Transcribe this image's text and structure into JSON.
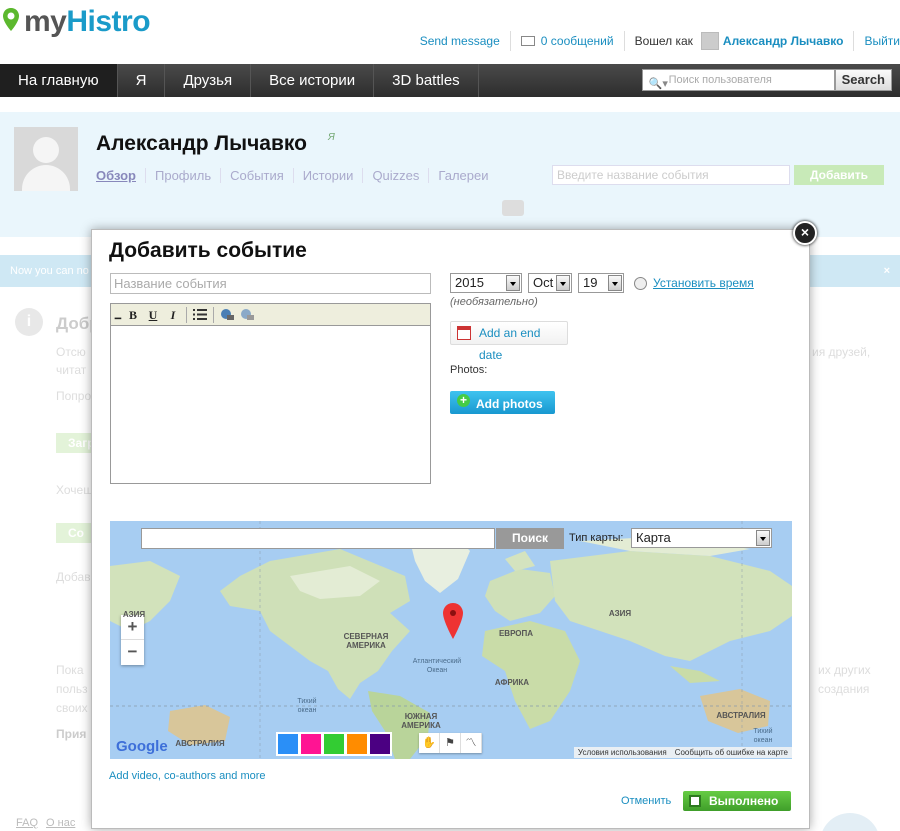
{
  "header": {
    "logo_my": "my",
    "logo_histro": "Histro",
    "send_message": "Send message",
    "messages": "0 сообщений",
    "logged_in_as": "Вошел как",
    "user_name": "Александр Лычавко",
    "logout": "Выйти"
  },
  "nav": {
    "items": [
      "На главную",
      "Я",
      "Друзья",
      "Все истории",
      "3D battles"
    ],
    "search_placeholder": "Поиск пользователя",
    "search_button": "Search"
  },
  "profile": {
    "name": "Александр Лычавко",
    "badge": "Я",
    "tabs": [
      "Обзор",
      "Профиль",
      "События",
      "Истории",
      "Quizzes",
      "Галереи"
    ],
    "event_search_placeholder": "Введите название события",
    "add_button": "Добавить"
  },
  "background": {
    "notice": "Now you can no",
    "notice_close": "×",
    "heading": "Добр",
    "p1": "Отсю",
    "p1_right": "ия друзей,",
    "p2": "читат",
    "p3": "Попро",
    "btn1": "Загр",
    "p4": "Хочеш",
    "btn2": "Со",
    "p5": "Добав",
    "p6": "Пока",
    "p6_right": "их других",
    "p7": "польз",
    "p7_right": "создания",
    "p8": "своих",
    "p9": "Прия",
    "footer_faq": "FAQ",
    "footer_about": "О нас"
  },
  "modal": {
    "title": "Добавить событие",
    "name_placeholder": "Название события",
    "close": "×",
    "toolbar": [
      "B",
      "U",
      "I"
    ],
    "year": "2015",
    "month": "Oct",
    "day": "19",
    "set_time": "Установить время",
    "optional": "(необязательно)",
    "add_end_date": "Add an end date",
    "photos_label": "Photos:",
    "add_photos": "Add photos",
    "add_video": "Add video, co-authors and more",
    "cancel": "Отменить",
    "done": "Выполнено"
  },
  "map": {
    "search_button": "Поиск",
    "type_label": "Тип карты:",
    "type_value": "Карта",
    "zoom_in": "+",
    "zoom_out": "−",
    "labels": {
      "asia_left": "АЗИЯ",
      "north_america": "СЕВЕРНАЯ АМЕРИКА",
      "europe": "ЕВРОПА",
      "asia_right": "АЗИЯ",
      "atlantic": "Атлантический Океан",
      "africa": "АФРИКА",
      "south_america": "ЮЖНАЯ АМЕРИКА",
      "australia_left": "АВСТРАЛИЯ",
      "australia_right": "АВСТРАЛИЯ",
      "pacific_left": "Тихий океан",
      "pacific_right": "Тихий океан"
    },
    "google": "Google",
    "terms": "Условия использования",
    "report": "Сообщить об ошибке на карте",
    "palette_colors": [
      "#2a8ff7",
      "#ff1493",
      "#33cc33",
      "#ff8c00",
      "#4b0082"
    ]
  }
}
